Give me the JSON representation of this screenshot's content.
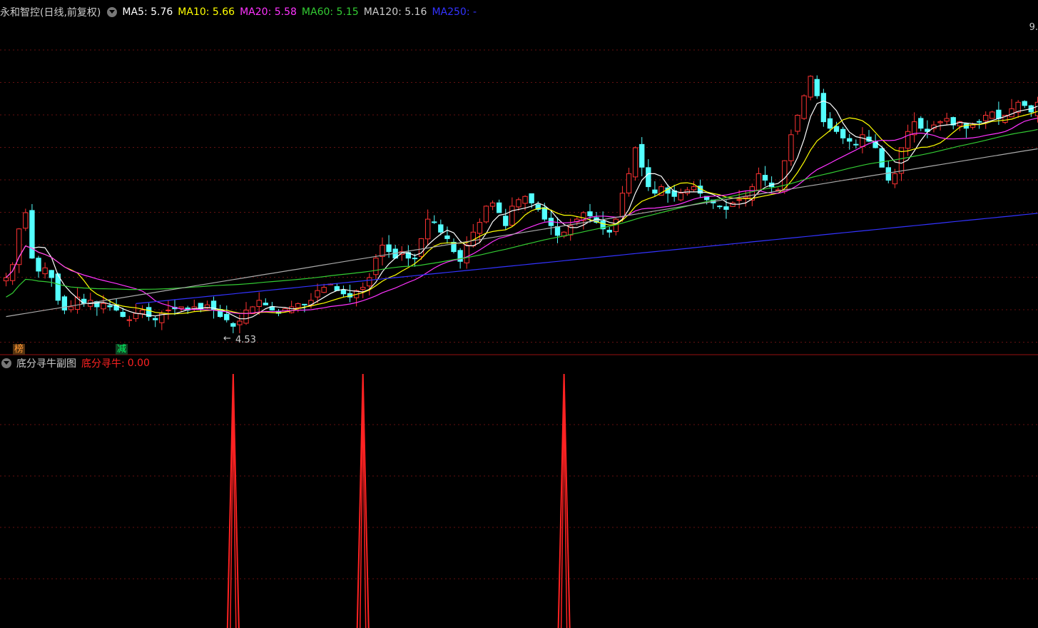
{
  "main_legend": {
    "title": "永和智控(日线,前复权)",
    "ma": [
      {
        "label": "MA5:",
        "value": "5.76",
        "color": "#ffffff"
      },
      {
        "label": "MA10:",
        "value": "5.66",
        "color": "#ffff00"
      },
      {
        "label": "MA20:",
        "value": "5.58",
        "color": "#ff33ff"
      },
      {
        "label": "MA60:",
        "value": "5.15",
        "color": "#33cc33"
      },
      {
        "label": "MA120:",
        "value": "5.16",
        "color": "#cccccc"
      },
      {
        "label": "MA250:",
        "value": "-",
        "color": "#3333ff"
      }
    ]
  },
  "sub_legend": {
    "title": "底分寻牛副图",
    "series_label": "底分寻牛:",
    "series_value": "0.00",
    "color": "#ff2222"
  },
  "badges": [
    {
      "text": "榜",
      "color": "#ff9933",
      "bg": "#553311"
    },
    {
      "text": "减",
      "color": "#00ff66",
      "bg": "#114422"
    }
  ],
  "price_label": "9.",
  "low_marker": "4.53",
  "chart_data": [
    {
      "type": "candlestick",
      "ylim": [
        4.2,
        9.2
      ],
      "x_count": 160,
      "closes": [
        5.2,
        5.4,
        5.95,
        6.2,
        5.5,
        5.3,
        5.35,
        5.2,
        4.85,
        4.7,
        4.75,
        4.9,
        4.8,
        4.85,
        4.75,
        4.8,
        4.75,
        4.7,
        4.6,
        4.55,
        4.65,
        4.7,
        4.6,
        4.55,
        4.65,
        4.7,
        4.72,
        4.75,
        4.7,
        4.75,
        4.72,
        4.78,
        4.7,
        4.6,
        4.55,
        4.45,
        4.53,
        4.7,
        4.75,
        4.85,
        4.78,
        4.7,
        4.65,
        4.72,
        4.75,
        4.8,
        4.78,
        4.85,
        5.0,
        5.05,
        5.1,
        5.0,
        4.95,
        4.9,
        5.0,
        5.05,
        5.2,
        5.5,
        5.7,
        5.6,
        5.5,
        5.6,
        5.5,
        5.5,
        5.8,
        6.1,
        6.05,
        5.9,
        5.8,
        5.6,
        5.45,
        5.7,
        5.9,
        6.05,
        6.3,
        6.35,
        6.2,
        6.0,
        6.3,
        6.4,
        6.45,
        6.35,
        6.25,
        6.1,
        6.0,
        5.85,
        5.9,
        6.0,
        6.1,
        6.2,
        6.15,
        6.05,
        5.95,
        5.9,
        6.1,
        6.5,
        6.8,
        7.2,
        6.9,
        6.6,
        6.5,
        6.6,
        6.5,
        6.45,
        6.5,
        6.55,
        6.6,
        6.5,
        6.4,
        6.35,
        6.3,
        6.25,
        6.35,
        6.4,
        6.45,
        6.6,
        6.8,
        6.7,
        6.6,
        6.55,
        7.0,
        7.4,
        7.7,
        8.0,
        8.3,
        8.0,
        7.6,
        7.5,
        7.45,
        7.35,
        7.3,
        7.25,
        7.4,
        7.3,
        7.2,
        6.9,
        6.7,
        6.8,
        7.2,
        7.45,
        7.6,
        7.5,
        7.45,
        7.55,
        7.6,
        7.65,
        7.55,
        7.6,
        7.5,
        7.55,
        7.6,
        7.7,
        7.75,
        7.65,
        7.7,
        7.8,
        7.9,
        7.85,
        7.75,
        7.9
      ],
      "ma_names": [
        "MA5",
        "MA10",
        "MA20",
        "MA60",
        "MA120",
        "MA250"
      ],
      "ma_colors": [
        "#ffffff",
        "#ffff00",
        "#ff33ff",
        "#33cc33",
        "#aaaaaa",
        "#3333ff"
      ]
    },
    {
      "type": "line",
      "ylim": [
        0,
        1
      ],
      "series_label": "底分寻牛",
      "spike_indices": [
        35,
        55,
        86
      ],
      "values_note_free": true
    }
  ]
}
